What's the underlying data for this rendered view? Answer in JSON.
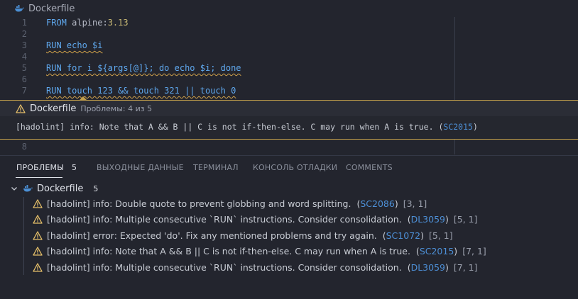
{
  "breadcrumb": {
    "file": "Dockerfile"
  },
  "editor": {
    "lines": [
      {
        "n": "1",
        "tokens": [
          {
            "t": "FROM",
            "c": "kw"
          },
          {
            "t": " alpine:",
            "c": "dim"
          },
          {
            "t": "3.13",
            "c": "str"
          }
        ]
      },
      {
        "n": "2",
        "tokens": []
      },
      {
        "n": "3",
        "tokens": [
          {
            "t": "RUN echo $i",
            "c": "kw squig"
          }
        ]
      },
      {
        "n": "4",
        "tokens": []
      },
      {
        "n": "5",
        "tokens": [
          {
            "t": "RUN for i ${args[@]}; do echo $i; done",
            "c": "kw squig"
          }
        ]
      },
      {
        "n": "6",
        "tokens": []
      },
      {
        "n": "7",
        "tokens": [
          {
            "t": "RUN touch 123 && touch 321 || touch 0",
            "c": "kw squig"
          }
        ]
      }
    ],
    "line8": "8"
  },
  "peek": {
    "file": "Dockerfile",
    "count": "Проблемы: 4 из 5",
    "message": "[hadolint] info: Note that A && B || C is not if-then-else. C may run when A is true.",
    "code": "SC2015"
  },
  "panel": {
    "tabs": [
      {
        "label": "ПРОБЛЕМЫ"
      },
      {
        "label": "ВЫХОДНЫЕ ДАННЫЕ"
      },
      {
        "label": "ТЕРМИНАЛ"
      },
      {
        "label": "КОНСОЛЬ ОТЛАДКИ"
      },
      {
        "label": "COMMENTS"
      }
    ],
    "problem_count": "5",
    "group": {
      "file": "Dockerfile",
      "count": "5"
    },
    "problems": [
      {
        "message": "[hadolint] info: Double quote to prevent globbing and word splitting.",
        "code": "SC2086",
        "location": "[3, 1]"
      },
      {
        "message": "[hadolint] info: Multiple consecutive `RUN` instructions. Consider consolidation.",
        "code": "DL3059",
        "location": "[5, 1]"
      },
      {
        "message": "[hadolint] error: Expected 'do'. Fix any mentioned problems and try again.",
        "code": "SC1072",
        "location": "[5, 1]"
      },
      {
        "message": "[hadolint] info: Note that A && B || C is not if-then-else. C may run when A is true.",
        "code": "SC2015",
        "location": "[7, 1]"
      },
      {
        "message": "[hadolint] info: Multiple consecutive `RUN` instructions. Consider consolidation.",
        "code": "DL3059",
        "location": "[7, 1]"
      }
    ]
  },
  "icons": {
    "file": "docker-whale-icon",
    "warning": "warning-triangle-icon",
    "chevron": "chevron-down-icon"
  },
  "colors": {
    "accent_warning": "#c5a14c",
    "link": "#4d8fd6",
    "keyword": "#5fa8ee",
    "number": "#c7b874"
  }
}
